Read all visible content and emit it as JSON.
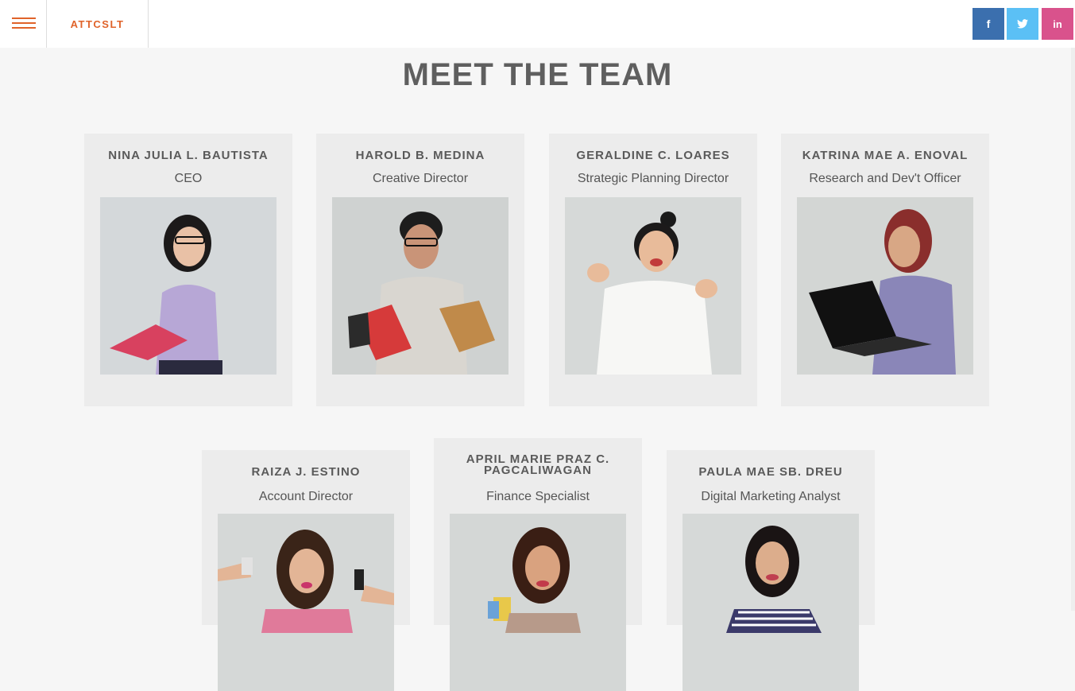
{
  "header": {
    "brand": "ATTCSLT",
    "social": [
      {
        "label": "f",
        "color": "#3b6fae"
      },
      {
        "label": "t",
        "color": "#5bc0f5"
      },
      {
        "label": "in",
        "color": "#d9528c"
      }
    ]
  },
  "main": {
    "title": "MEET THE TEAM",
    "team": [
      {
        "name": "NINA JULIA L. BAUTISTA",
        "role": "CEO"
      },
      {
        "name": "HAROLD B. MEDINA",
        "role": "Creative Director"
      },
      {
        "name": "GERALDINE C. LOARES",
        "role": "Strategic Planning Director"
      },
      {
        "name": "KATRINA MAE A. ENOVAL",
        "role": "Research and Dev't Officer"
      },
      {
        "name": "RAIZA J. ESTINO",
        "role": "Account Director"
      },
      {
        "name": "APRIL MARIE PRAZ C. PAGCALIWAGAN",
        "role": "Finance Specialist"
      },
      {
        "name": "PAULA MAE SB. DREU",
        "role": "Digital Marketing Analyst"
      }
    ]
  }
}
